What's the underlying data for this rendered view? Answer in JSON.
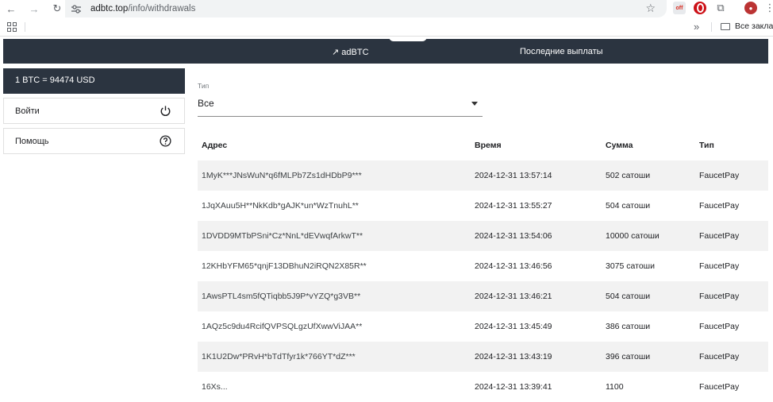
{
  "browser": {
    "url_host": "adbtc.top",
    "url_path": "/info/withdrawals",
    "bookmarks_folder_label": "Все закладк",
    "bookmarks_overflow": "»",
    "icons": [
      "back-arrow-icon",
      "forward-arrow-icon",
      "reload-icon",
      "site-settings-icon",
      "star-icon",
      "extension-icon",
      "puzzle-icon",
      "profile-avatar",
      "kebab-menu-icon",
      "apps-grid-icon",
      "folder-icon"
    ]
  },
  "header": {
    "site_link": "↗ adBTC",
    "title": "Последние выплаты"
  },
  "sidebar": {
    "btc_rate": "1 BTC = 94474 USD",
    "login_label": "Войти",
    "help_label": "Помощь"
  },
  "filter": {
    "label": "Тип",
    "value": "Все"
  },
  "table": {
    "headers": {
      "address": "Адрес",
      "time": "Время",
      "sum": "Сумма",
      "type": "Тип"
    },
    "rows": [
      {
        "address": "1MyK***JNsWuN*q6fMLPb7Zs1dHDbP9***",
        "time": "2024-12-31 13:57:14",
        "sum": "502 сатоши",
        "type": "FaucetPay"
      },
      {
        "address": "1JqXAuu5H**NkKdb*gAJK*un*WzTnuhL**",
        "time": "2024-12-31 13:55:27",
        "sum": "504 сатоши",
        "type": "FaucetPay"
      },
      {
        "address": "1DVDD9MTbPSni*Cz*NnL*dEVwqfArkwT**",
        "time": "2024-12-31 13:54:06",
        "sum": "10000 сатоши",
        "type": "FaucetPay"
      },
      {
        "address": "12KHbYFM65*qnjF13DBhuN2iRQN2X85R**",
        "time": "2024-12-31 13:46:56",
        "sum": "3075 сатоши",
        "type": "FaucetPay"
      },
      {
        "address": "1AwsPTL4sm5fQTiqbb5J9P*vYZQ*g3VB**",
        "time": "2024-12-31 13:46:21",
        "sum": "504 сатоши",
        "type": "FaucetPay"
      },
      {
        "address": "1AQz5c9du4RcifQVPSQLgzUfXwwViJAA**",
        "time": "2024-12-31 13:45:49",
        "sum": "386 сатоши",
        "type": "FaucetPay"
      },
      {
        "address": "1K1U2Dw*PRvH*bTdTfyr1k*766YT*dZ***",
        "time": "2024-12-31 13:43:19",
        "sum": "396 сатоши",
        "type": "FaucetPay"
      },
      {
        "address": "16Xs...",
        "time": "2024-12-31 13:39:41",
        "sum": "1100",
        "type": "FaucetPay"
      }
    ]
  }
}
